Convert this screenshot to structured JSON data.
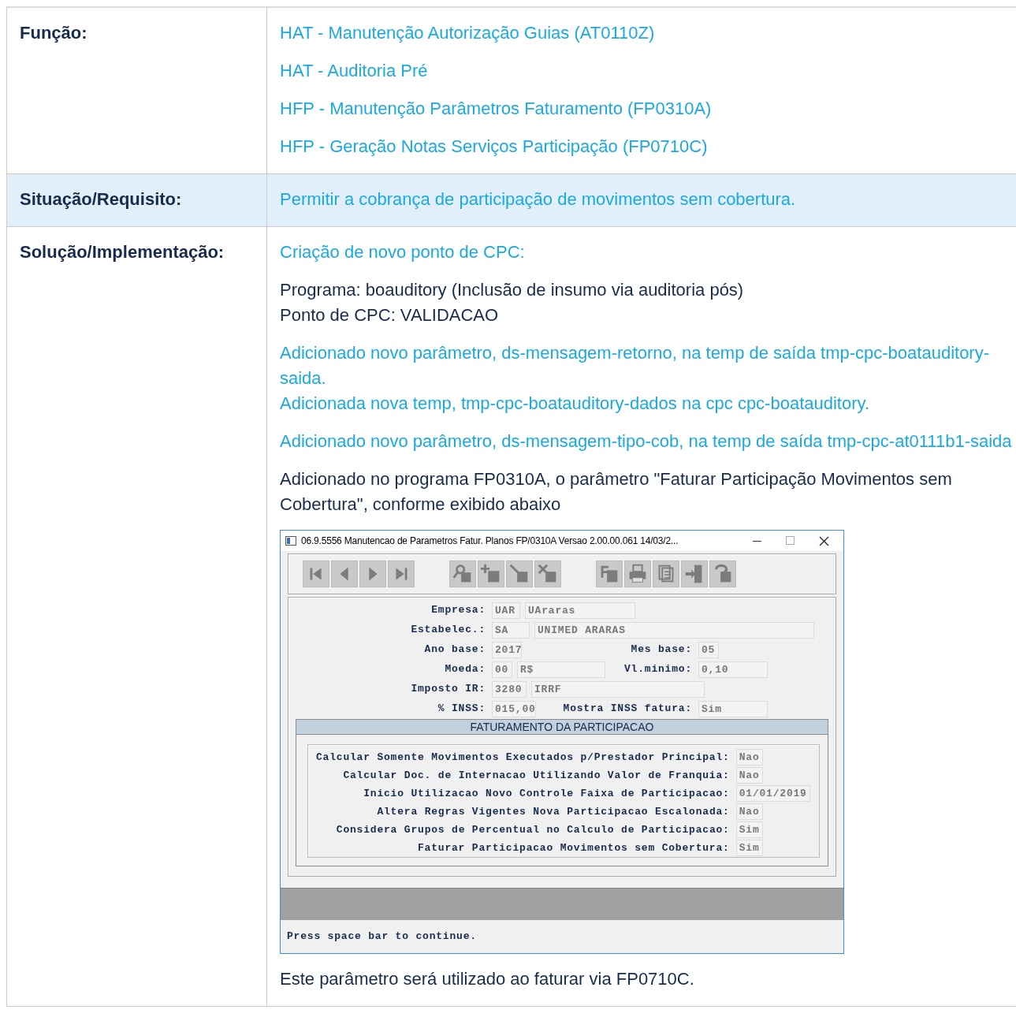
{
  "rows": [
    {
      "label": "Função:",
      "highlighted": false,
      "content": [
        {
          "kind": "link",
          "lines": [
            "HAT - Manutenção Autorização Guias (AT0110Z)"
          ]
        },
        {
          "kind": "link",
          "lines": [
            "HAT - Auditoria Pré"
          ]
        },
        {
          "kind": "link",
          "lines": [
            "HFP - Manutenção Parâmetros Faturamento (FP0310A)"
          ]
        },
        {
          "kind": "link",
          "lines": [
            "HFP - Geração Notas Serviços Participação (FP0710C)"
          ]
        }
      ]
    },
    {
      "label": "Situação/Requisito:",
      "highlighted": true,
      "content": [
        {
          "kind": "blue",
          "lines": [
            "Permitir a cobrança de participação de movimentos sem cobertura."
          ]
        }
      ]
    },
    {
      "label": "Solução/Implementação:",
      "highlighted": false,
      "content": [
        {
          "kind": "blue",
          "lines": [
            "Criação de novo ponto de CPC:"
          ]
        },
        {
          "kind": "text",
          "lines": [
            "Programa: boauditory (Inclusão de insumo via auditoria pós)",
            "Ponto de CPC: VALIDACAO"
          ]
        },
        {
          "kind": "blue",
          "lines": [
            "Adicionado novo parâmetro, ds-mensagem-retorno, na temp de saída tmp-cpc-boatauditory-saida.",
            "Adicionada nova temp, tmp-cpc-boatauditory-dados na cpc cpc-boatauditory."
          ]
        },
        {
          "kind": "blue",
          "lines": [
            "Adicionado novo parâmetro, ds-mensagem-tipo-cob, na temp de saída tmp-cpc-at0111b1-saida"
          ]
        },
        {
          "kind": "text",
          "lines": [
            "Adicionado no programa FP0310A, o parâmetro \"Faturar Participação Movimentos sem Cobertura\", conforme exibido abaixo"
          ]
        },
        {
          "kind": "window",
          "window": {
            "title": "06.9.5556 Manutencao  de Parametros Fatur. Planos FP/0310A Versao 2.00.00.061 14/03/2...",
            "fields": [
              {
                "label": "Empresa:",
                "values": [
                  "UAR",
                  "UAraras"
                ]
              },
              {
                "label": "Estabelec.:",
                "values": [
                  "SA",
                  "UNIMED ARARAS"
                ]
              },
              {
                "label": "Ano base:",
                "values": [
                  "2017"
                ],
                "second_label": "Mes base:",
                "second_values": [
                  "05"
                ]
              },
              {
                "label": "Moeda:",
                "values": [
                  "00",
                  "R$"
                ],
                "second_label": "Vl.minimo:",
                "second_values": [
                  "0,10"
                ]
              },
              {
                "label": "Imposto IR:",
                "values": [
                  "3280",
                  "IRRF"
                ]
              },
              {
                "label": "% INSS:",
                "values": [
                  "015,00"
                ],
                "second_label": "Mostra INSS fatura:",
                "second_values": [
                  "Sim"
                ]
              }
            ],
            "section_title": "FATURAMENTO DA PARTICIPACAO",
            "section_fields": [
              {
                "label": "Calcular Somente Movimentos Executados p/Prestador Principal:",
                "value": "Nao"
              },
              {
                "label": "Calcular Doc. de Internacao Utilizando Valor de Franquia:",
                "value": "Nao"
              },
              {
                "label": "Inicio Utilizacao Novo Controle Faixa de Participacao:",
                "value": "01/01/2019"
              },
              {
                "label": "Altera Regras Vigentes Nova Participacao Escalonada:",
                "value": "Nao"
              },
              {
                "label": "Considera Grupos de Percentual no Calculo de Participacao:",
                "value": "Sim"
              },
              {
                "label": "Faturar Participacao Movimentos sem Cobertura:",
                "value": "Sim"
              }
            ],
            "status": "Press space bar to continue."
          }
        },
        {
          "kind": "text",
          "lines": [
            "Este parâmetro será utilizado ao faturar via FP0710C."
          ]
        }
      ]
    }
  ]
}
